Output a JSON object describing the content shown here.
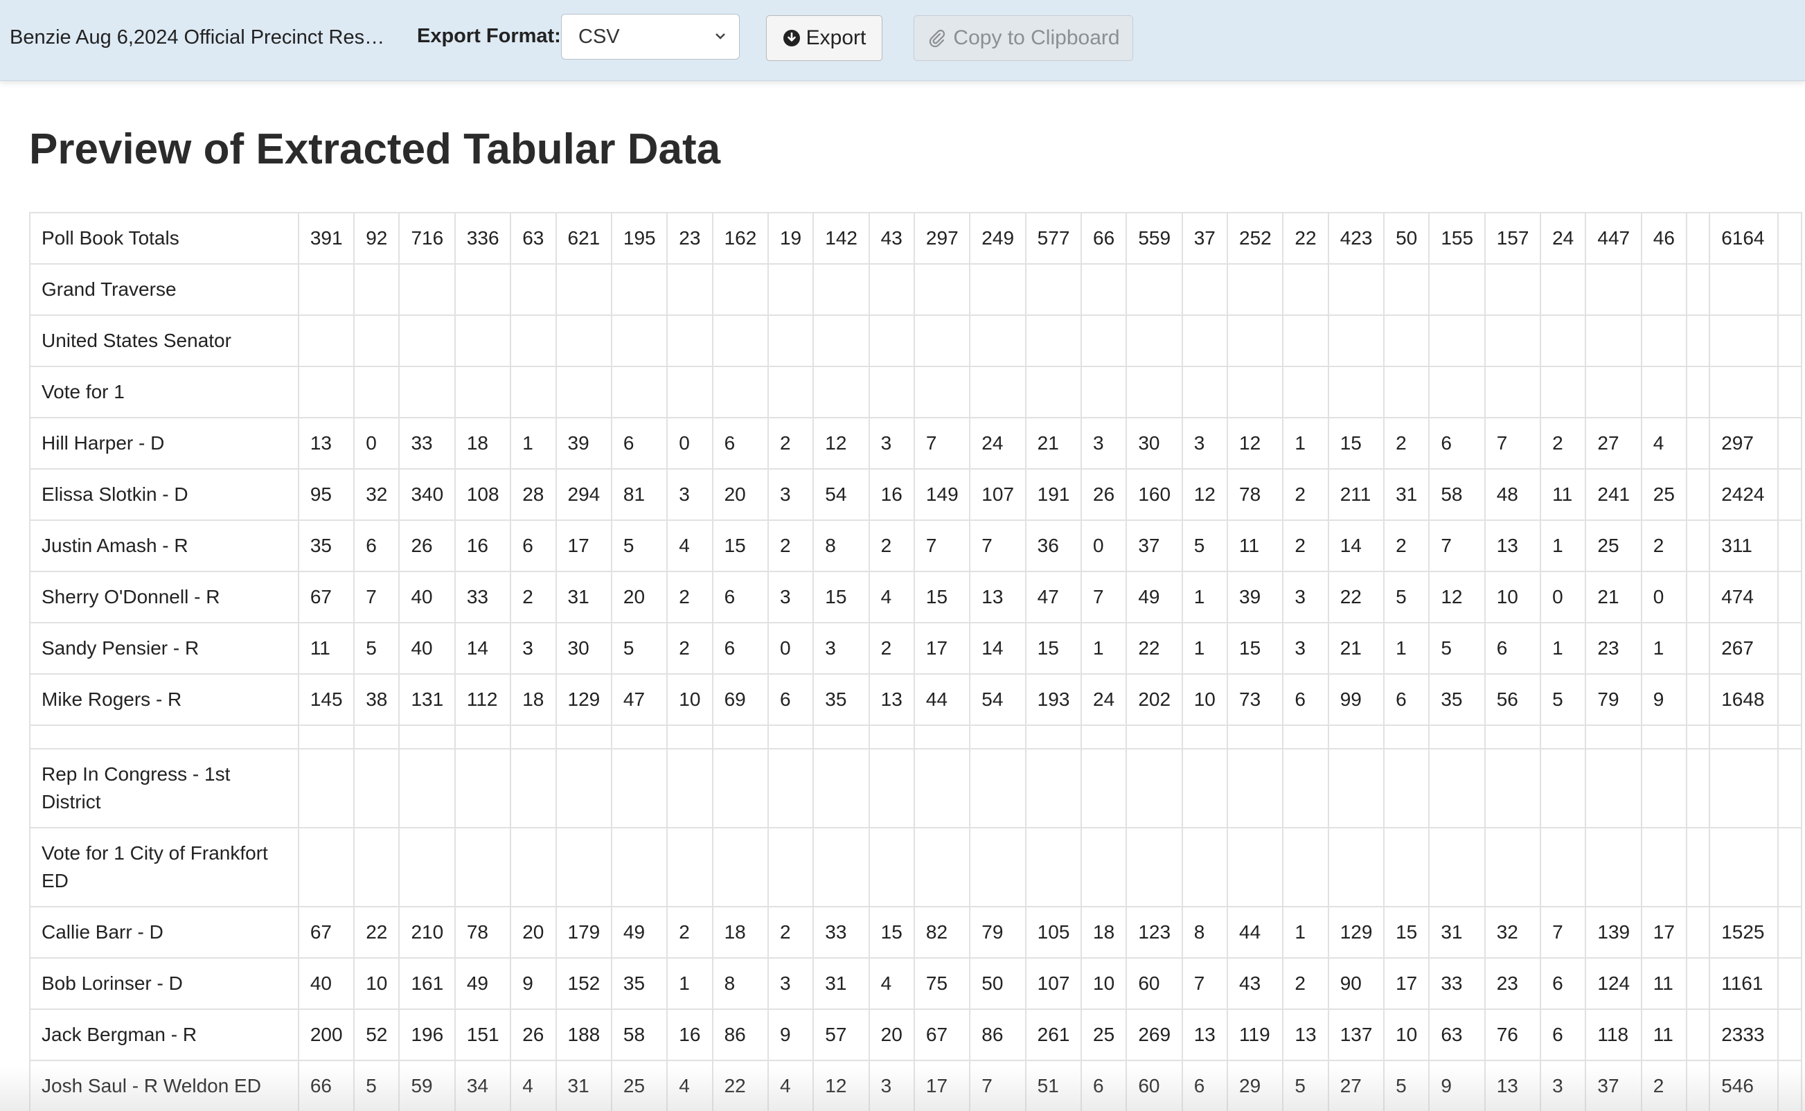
{
  "toolbar": {
    "doc_title": "Benzie Aug 6,2024 Official Precinct Resu...",
    "format_label": "Export Format:",
    "format_value": "CSV",
    "export_label": "Export",
    "copy_label": "Copy to Clipboard",
    "icons": {
      "export": "download-circle-icon",
      "copy": "paperclip-icon",
      "select": "chevron-down-icon"
    }
  },
  "main": {
    "title": "Preview of Extracted Tabular Data"
  },
  "table": {
    "rows": [
      [
        "Poll Book Totals",
        "391",
        "92",
        "716",
        "336",
        "63",
        "621",
        "195",
        "23",
        "162",
        "19",
        "142",
        "43",
        "297",
        "249",
        "577",
        "66",
        "559",
        "37",
        "252",
        "22",
        "423",
        "50",
        "155",
        "157",
        "24",
        "447",
        "46",
        "",
        "6164"
      ],
      [
        "Grand Traverse",
        "",
        "",
        "",
        "",
        "",
        "",
        "",
        "",
        "",
        "",
        "",
        "",
        "",
        "",
        "",
        "",
        "",
        "",
        "",
        "",
        "",
        "",
        "",
        "",
        "",
        "",
        "",
        "",
        ""
      ],
      [
        "United States Senator",
        "",
        "",
        "",
        "",
        "",
        "",
        "",
        "",
        "",
        "",
        "",
        "",
        "",
        "",
        "",
        "",
        "",
        "",
        "",
        "",
        "",
        "",
        "",
        "",
        "",
        "",
        "",
        "",
        ""
      ],
      [
        "Vote for 1",
        "",
        "",
        "",
        "",
        "",
        "",
        "",
        "",
        "",
        "",
        "",
        "",
        "",
        "",
        "",
        "",
        "",
        "",
        "",
        "",
        "",
        "",
        "",
        "",
        "",
        "",
        "",
        "",
        ""
      ],
      [
        "Hill Harper - D",
        "13",
        "0",
        "33",
        "18",
        "1",
        "39",
        "6",
        "0",
        "6",
        "2",
        "12",
        "3",
        "7",
        "24",
        "21",
        "3",
        "30",
        "3",
        "12",
        "1",
        "15",
        "2",
        "6",
        "7",
        "2",
        "27",
        "4",
        "",
        "297"
      ],
      [
        "Elissa Slotkin - D",
        "95",
        "32",
        "340",
        "108",
        "28",
        "294",
        "81",
        "3",
        "20",
        "3",
        "54",
        "16",
        "149",
        "107",
        "191",
        "26",
        "160",
        "12",
        "78",
        "2",
        "211",
        "31",
        "58",
        "48",
        "11",
        "241",
        "25",
        "",
        "2424"
      ],
      [
        "Justin Amash - R",
        "35",
        "6",
        "26",
        "16",
        "6",
        "17",
        "5",
        "4",
        "15",
        "2",
        "8",
        "2",
        "7",
        "7",
        "36",
        "0",
        "37",
        "5",
        "11",
        "2",
        "14",
        "2",
        "7",
        "13",
        "1",
        "25",
        "2",
        "",
        "311"
      ],
      [
        "Sherry O'Donnell - R",
        "67",
        "7",
        "40",
        "33",
        "2",
        "31",
        "20",
        "2",
        "6",
        "3",
        "15",
        "4",
        "15",
        "13",
        "47",
        "7",
        "49",
        "1",
        "39",
        "3",
        "22",
        "5",
        "12",
        "10",
        "0",
        "21",
        "0",
        "",
        "474"
      ],
      [
        "Sandy Pensier - R",
        "11",
        "5",
        "40",
        "14",
        "3",
        "30",
        "5",
        "2",
        "6",
        "0",
        "3",
        "2",
        "17",
        "14",
        "15",
        "1",
        "22",
        "1",
        "15",
        "3",
        "21",
        "1",
        "5",
        "6",
        "1",
        "23",
        "1",
        "",
        "267"
      ],
      [
        "Mike Rogers - R",
        "145",
        "38",
        "131",
        "112",
        "18",
        "129",
        "47",
        "10",
        "69",
        "6",
        "35",
        "13",
        "44",
        "54",
        "193",
        "24",
        "202",
        "10",
        "73",
        "6",
        "99",
        "6",
        "35",
        "56",
        "5",
        "79",
        "9",
        "",
        "1648"
      ],
      [
        "",
        "",
        "",
        "",
        "",
        "",
        "",
        "",
        "",
        "",
        "",
        "",
        "",
        "",
        "",
        "",
        "",
        "",
        "",
        "",
        "",
        "",
        "",
        "",
        "",
        "",
        "",
        "",
        "",
        ""
      ],
      [
        "Rep In Congress - 1st District",
        "",
        "",
        "",
        "",
        "",
        "",
        "",
        "",
        "",
        "",
        "",
        "",
        "",
        "",
        "",
        "",
        "",
        "",
        "",
        "",
        "",
        "",
        "",
        "",
        "",
        "",
        "",
        "",
        ""
      ],
      [
        "Vote for 1 City of Frankfort ED",
        "",
        "",
        "",
        "",
        "",
        "",
        "",
        "",
        "",
        "",
        "",
        "",
        "",
        "",
        "",
        "",
        "",
        "",
        "",
        "",
        "",
        "",
        "",
        "",
        "",
        "",
        "",
        "",
        ""
      ],
      [
        "Callie Barr - D",
        "67",
        "22",
        "210",
        "78",
        "20",
        "179",
        "49",
        "2",
        "18",
        "2",
        "33",
        "15",
        "82",
        "79",
        "105",
        "18",
        "123",
        "8",
        "44",
        "1",
        "129",
        "15",
        "31",
        "32",
        "7",
        "139",
        "17",
        "",
        "1525"
      ],
      [
        "Bob Lorinser - D",
        "40",
        "10",
        "161",
        "49",
        "9",
        "152",
        "35",
        "1",
        "8",
        "3",
        "31",
        "4",
        "75",
        "50",
        "107",
        "10",
        "60",
        "7",
        "43",
        "2",
        "90",
        "17",
        "33",
        "23",
        "6",
        "124",
        "11",
        "",
        "1161"
      ],
      [
        "Jack Bergman - R",
        "200",
        "52",
        "196",
        "151",
        "26",
        "188",
        "58",
        "16",
        "86",
        "9",
        "57",
        "20",
        "67",
        "86",
        "261",
        "25",
        "269",
        "13",
        "119",
        "13",
        "137",
        "10",
        "63",
        "76",
        "6",
        "118",
        "11",
        "",
        "2333"
      ],
      [
        "Josh Saul - R Weldon ED",
        "66",
        "5",
        "59",
        "34",
        "4",
        "31",
        "25",
        "4",
        "22",
        "4",
        "12",
        "3",
        "17",
        "7",
        "51",
        "6",
        "60",
        "6",
        "29",
        "5",
        "27",
        "5",
        "9",
        "13",
        "3",
        "37",
        "2",
        "",
        "546"
      ]
    ]
  }
}
